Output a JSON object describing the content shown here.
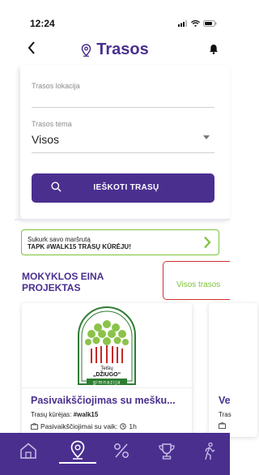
{
  "status_bar": {
    "time": "12:24"
  },
  "header": {
    "title": "Trasos"
  },
  "search_form": {
    "location_label": "Trasos lokacija",
    "theme_label": "Trasos tema",
    "theme_value": "Visos",
    "search_button": "IEŠKOTI TRASŲ"
  },
  "promo": {
    "line1": "Sukurk savo maršrutą",
    "line2": "TAPK #WALK15 TRASŲ KŪRĖJU!"
  },
  "section": {
    "title": "MOKYKLOS EINA PROJEKTAS",
    "all_link": "Visos trasos"
  },
  "cards": [
    {
      "logo_text": "Telšių „DŽIUGO“ gimnazija",
      "title": "Pasivaikščiojimas su mešku...",
      "author_label": "Trasų kūrėjas: ",
      "author": "#walk15",
      "category": "Pasivaikščiojimai su vaik:",
      "duration": "1h"
    },
    {
      "title": "Ve",
      "author_label": "Tras"
    }
  ],
  "tabbar": {
    "items": [
      "home-icon",
      "location-pin-icon",
      "percent-icon",
      "trophy-icon",
      "walker-icon"
    ],
    "active": "location-pin-icon"
  },
  "colors": {
    "brand": "#4a2f8f",
    "accent": "#7cc33a",
    "highlight": "#d32f2f"
  }
}
